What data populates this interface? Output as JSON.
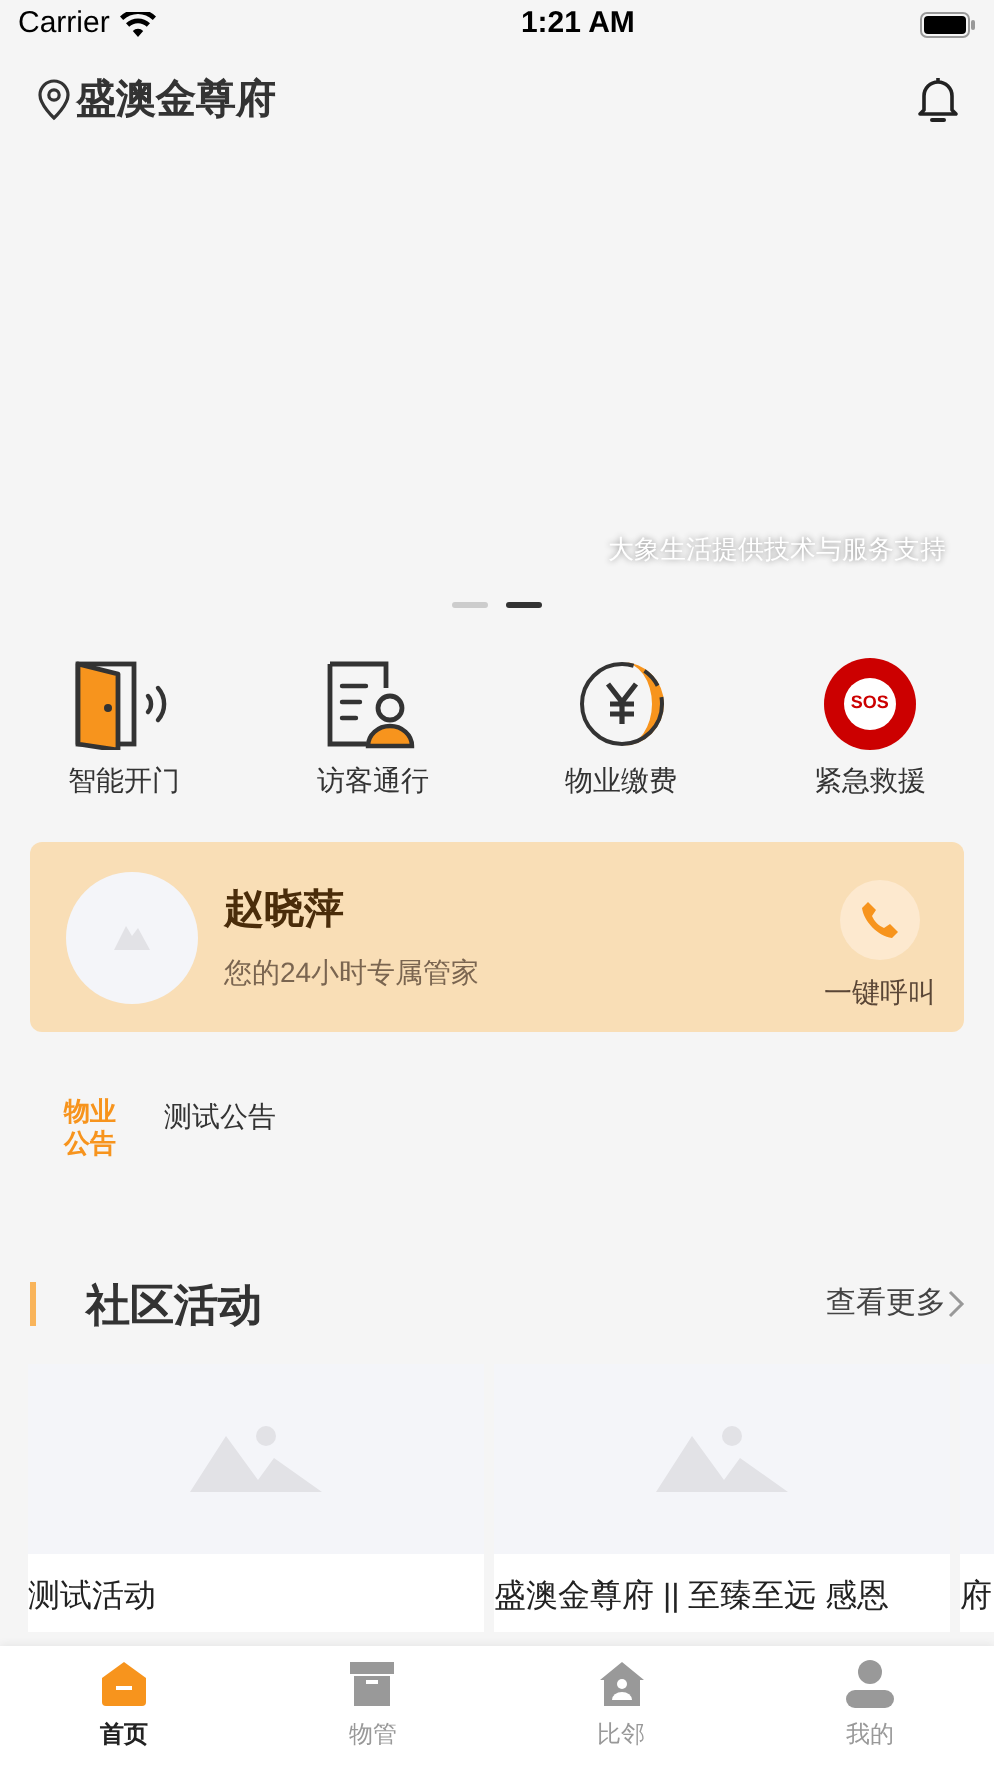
{
  "status_bar": {
    "carrier": "Carrier",
    "time": "1:21 AM"
  },
  "header": {
    "location": "盛澳金尊府"
  },
  "banner": {
    "caption": "大象生活提供技术与服务支持",
    "dots": [
      {
        "selected": false
      },
      {
        "selected": true
      }
    ]
  },
  "shortcuts": [
    {
      "kind": "door",
      "label": "智能开门"
    },
    {
      "kind": "visitor",
      "label": "访客通行"
    },
    {
      "kind": "payment",
      "label": "物业缴费"
    },
    {
      "kind": "sos",
      "label": "紧急救援",
      "icon_text": "SOS"
    }
  ],
  "butler": {
    "name": "赵晓萍",
    "subtitle": "您的24小时专属管家",
    "call_label": "一键呼叫"
  },
  "notice": {
    "badge_line_1": "物业",
    "badge_line_2": "公告",
    "text": "测试公告"
  },
  "activities": {
    "title": "社区活动",
    "more": "查看更多",
    "items": [
      {
        "title": "测试活动"
      },
      {
        "title": "盛澳金尊府 || 至臻至远 感恩"
      },
      {
        "title": "府"
      }
    ]
  },
  "tab_bar": [
    {
      "kind": "home",
      "label": "首页",
      "selected": true
    },
    {
      "kind": "box",
      "label": "物管",
      "selected": false
    },
    {
      "kind": "house",
      "label": "比邻",
      "selected": false
    },
    {
      "kind": "person",
      "label": "我的",
      "selected": false
    }
  ]
}
